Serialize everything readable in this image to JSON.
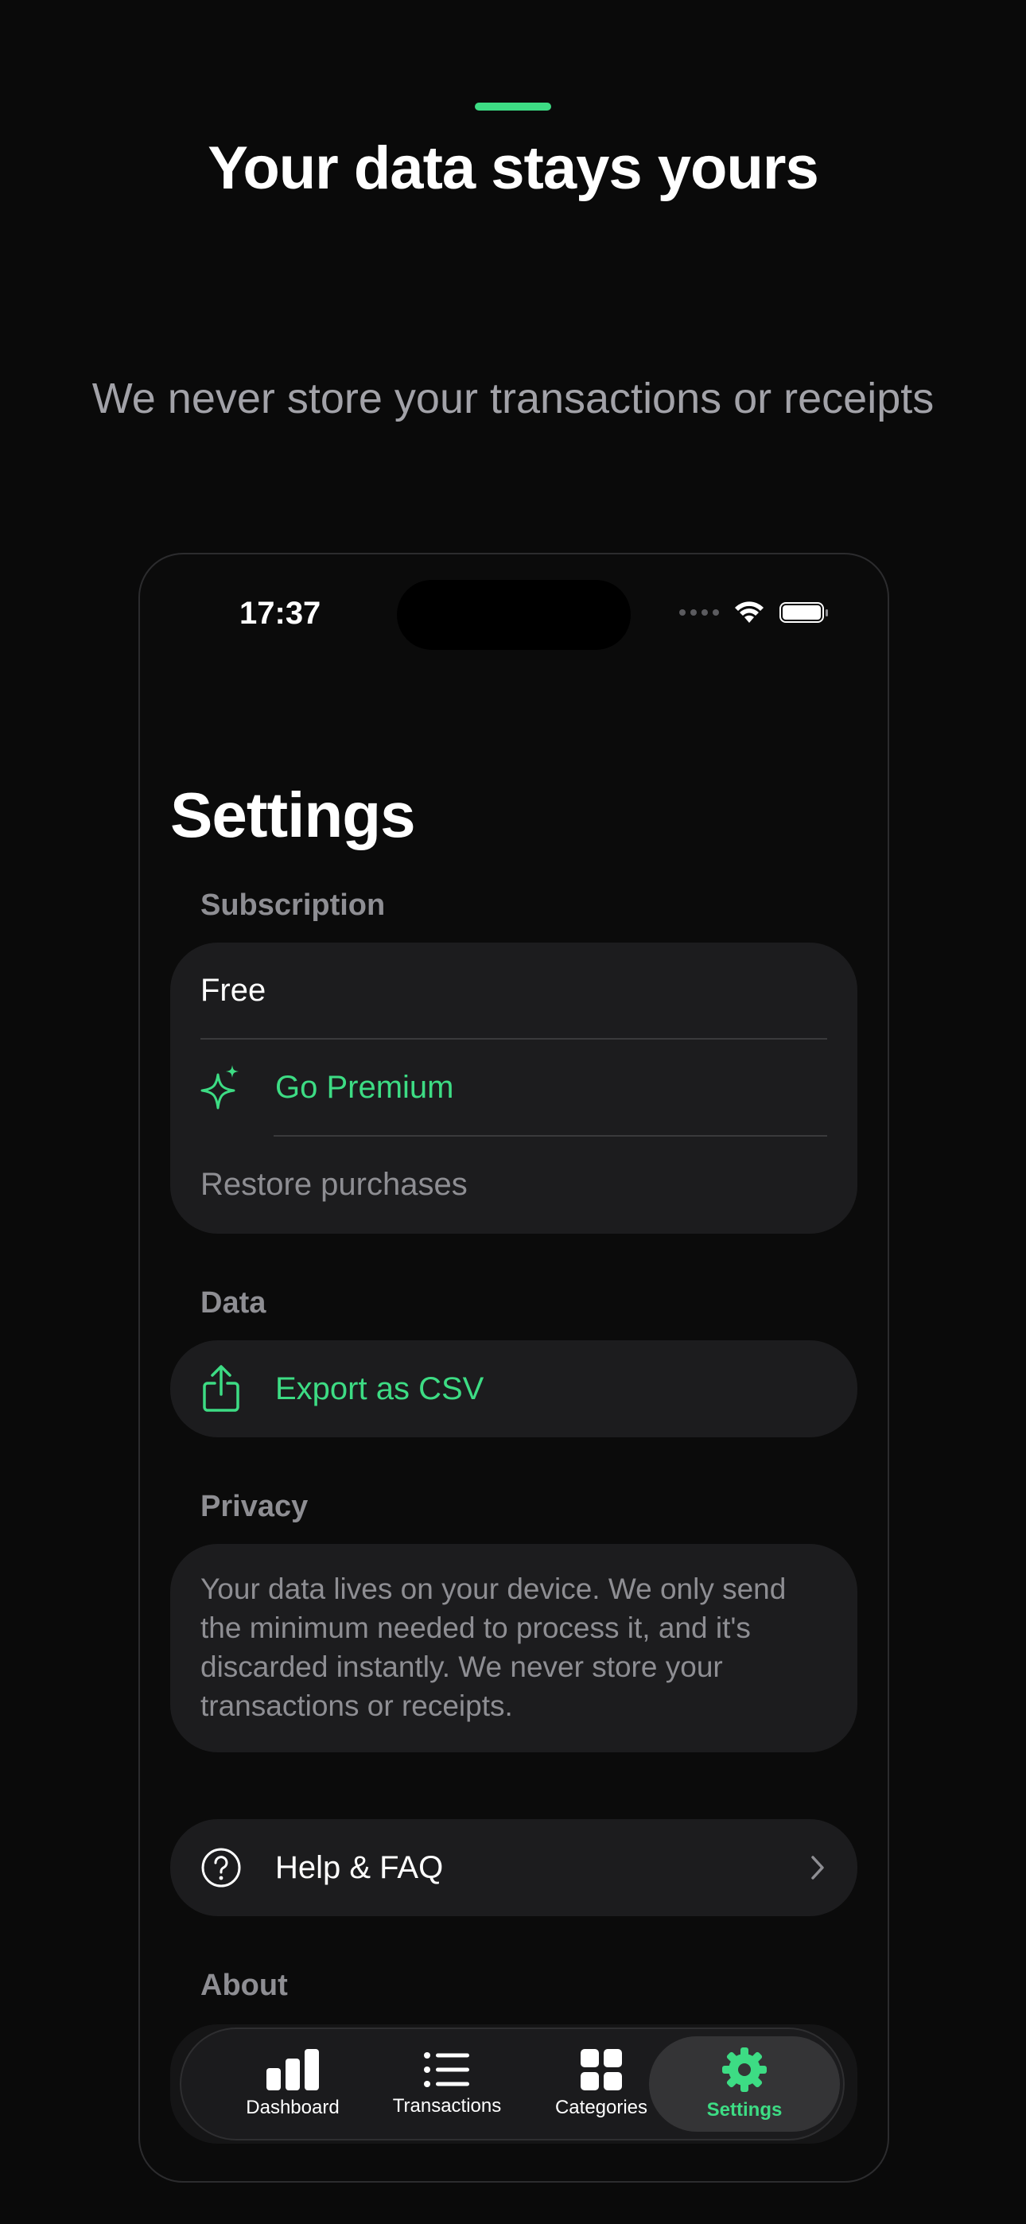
{
  "marketing": {
    "headline": "Your data stays yours",
    "subheadline": "We never store your transactions or receipts"
  },
  "status_bar": {
    "time": "17:37"
  },
  "screen": {
    "title": "Settings"
  },
  "subscription": {
    "header": "Subscription",
    "plan": "Free",
    "go_premium": "Go Premium",
    "restore": "Restore purchases"
  },
  "data_section": {
    "header": "Data",
    "export": "Export as CSV"
  },
  "privacy": {
    "header": "Privacy",
    "text": "Your data lives on your device. We only send the minimum needed to process it, and it's discarded instantly. We never store your transactions or receipts."
  },
  "help": {
    "label": "Help & FAQ"
  },
  "about": {
    "header": "About"
  },
  "tabs": [
    {
      "label": "Dashboard",
      "icon": "bar-chart-icon",
      "active": false
    },
    {
      "label": "Transactions",
      "icon": "list-icon",
      "active": false
    },
    {
      "label": "Categories",
      "icon": "grid-icon",
      "active": false
    },
    {
      "label": "Settings",
      "icon": "gear-icon",
      "active": true
    }
  ],
  "colors": {
    "accent": "#3ddc84",
    "background": "#0a0a0a",
    "card": "#1c1c1e",
    "secondary_text": "#8e8e93"
  }
}
